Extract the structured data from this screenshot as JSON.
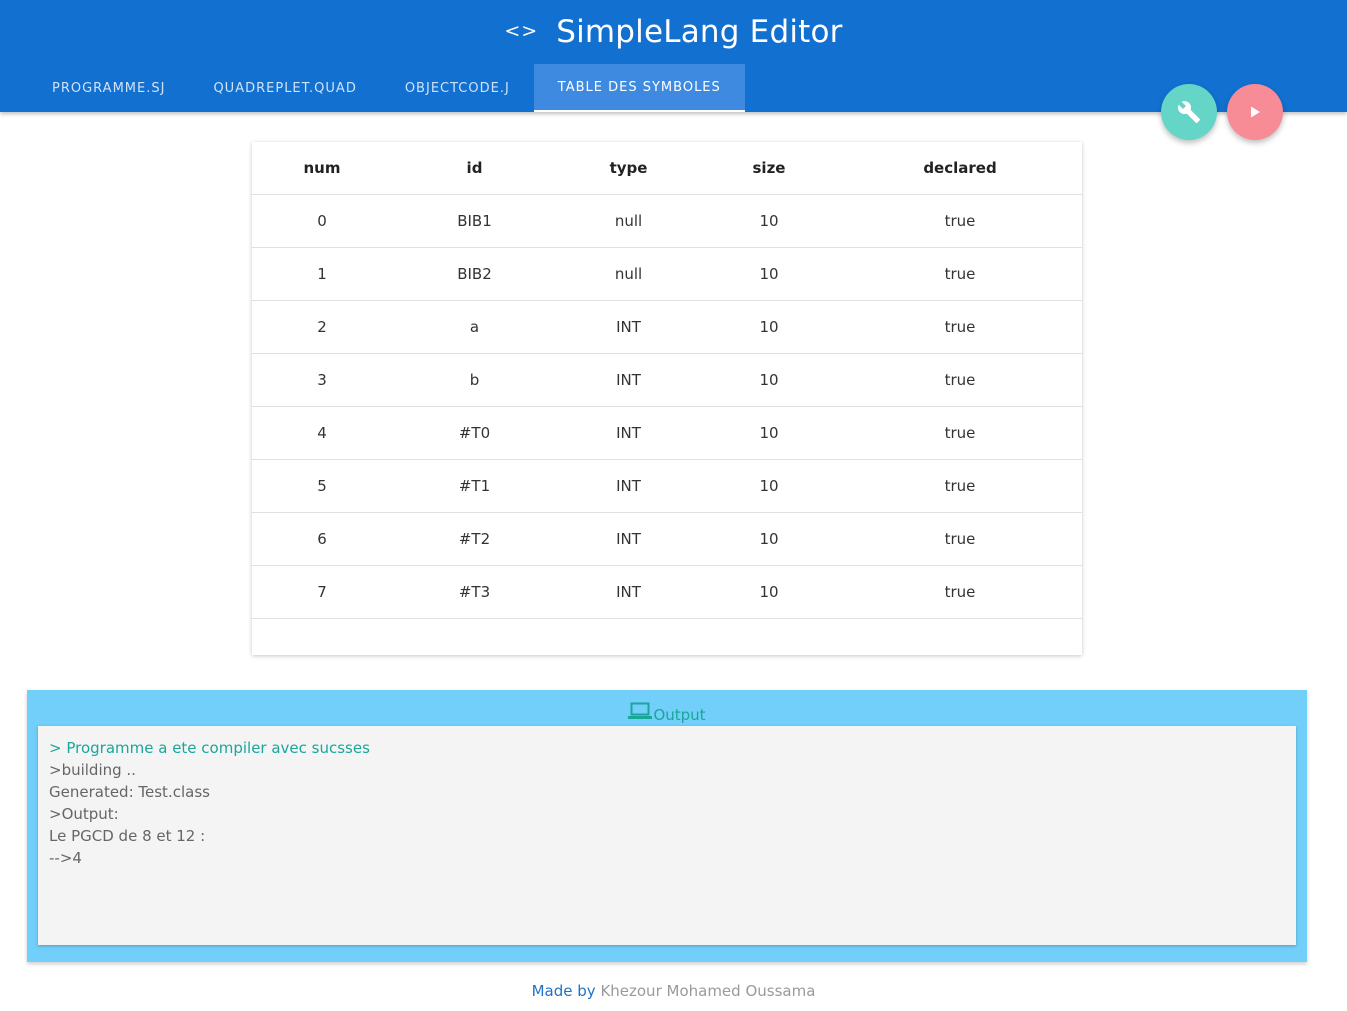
{
  "app": {
    "title": "SimpleLang Editor",
    "code_icon_glyph": "<>"
  },
  "tabs": [
    {
      "label": "PROGRAMME.SJ",
      "active": false
    },
    {
      "label": "QUADREPLET.QUAD",
      "active": false
    },
    {
      "label": "OBJECTCODE.J",
      "active": false
    },
    {
      "label": "TABLE DES SYMBOLES",
      "active": true
    }
  ],
  "fabs": {
    "build_icon": "wrench-icon",
    "run_icon": "play-icon"
  },
  "symbol_table": {
    "headers": [
      "num",
      "id",
      "type",
      "size",
      "declared"
    ],
    "rows": [
      [
        "0",
        "BIB1",
        "null",
        "10",
        "true"
      ],
      [
        "1",
        "BIB2",
        "null",
        "10",
        "true"
      ],
      [
        "2",
        "a",
        "INT",
        "10",
        "true"
      ],
      [
        "3",
        "b",
        "INT",
        "10",
        "true"
      ],
      [
        "4",
        "#T0",
        "INT",
        "10",
        "true"
      ],
      [
        "5",
        "#T1",
        "INT",
        "10",
        "true"
      ],
      [
        "6",
        "#T2",
        "INT",
        "10",
        "true"
      ],
      [
        "7",
        "#T3",
        "INT",
        "10",
        "true"
      ]
    ]
  },
  "output": {
    "title": "Output",
    "icon": "laptop-icon",
    "lines": [
      "> Programme a ete compiler avec sucsses",
      ">building ..",
      "Generated: Test.class",
      ">Output:",
      "Le PGCD de 8 et 12 :",
      "-->4"
    ]
  },
  "footer": {
    "made_by": "Made by",
    "author": "Khezour Mohamed Oussama"
  },
  "colors": {
    "appbar": "#1270d0",
    "active_tab": "#3e8ae0",
    "fab_build": "#64d5c6",
    "fab_run": "#f78b96",
    "output_panel": "#71cff9",
    "success_text": "#1aa69a"
  }
}
